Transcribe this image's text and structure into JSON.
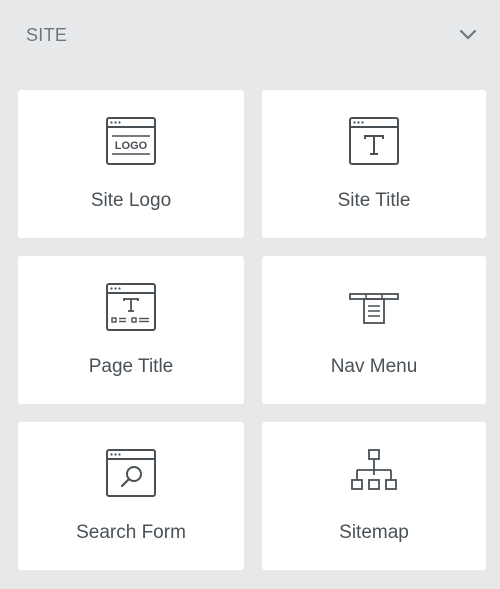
{
  "section": {
    "title": "SITE",
    "toggle_icon": "chevron-down-icon"
  },
  "widgets": [
    {
      "label": "Site Logo",
      "icon": "site-logo-icon"
    },
    {
      "label": "Site Title",
      "icon": "site-title-icon"
    },
    {
      "label": "Page Title",
      "icon": "page-title-icon"
    },
    {
      "label": "Nav Menu",
      "icon": "nav-menu-icon"
    },
    {
      "label": "Search Form",
      "icon": "search-form-icon"
    },
    {
      "label": "Sitemap",
      "icon": "sitemap-icon"
    }
  ],
  "icon_logo_text": "LOGO",
  "colors": {
    "background": "#e6e8ea",
    "card": "#ffffff",
    "text": "#495157",
    "header_text": "#6d7882",
    "icon_stroke": "#495157"
  }
}
